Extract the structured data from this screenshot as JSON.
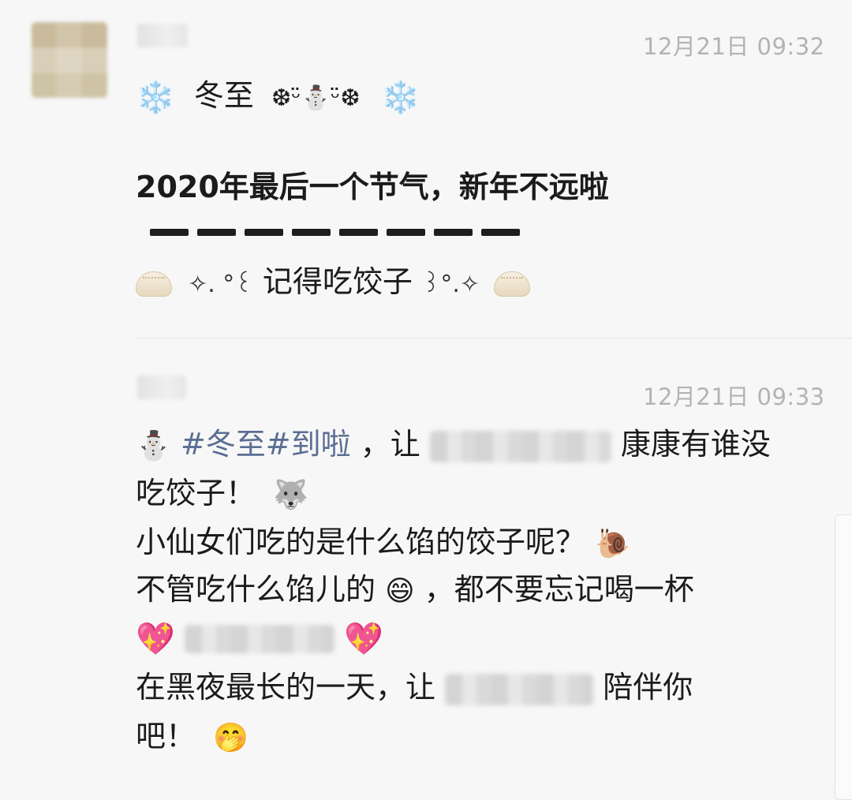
{
  "posts": [
    {
      "timestamp": "12月21日 09:32",
      "lines": {
        "title": {
          "pre": "❄️",
          "text": "冬至",
          "deco": "❆ᵕ̈⛄ᵕ̈❆",
          "post": "❄️"
        },
        "headline": "2020年最后一个节气，新年不远啦",
        "dashes_count": 8,
        "reminder": {
          "left_deco": "✧. °꒰",
          "text": "记得吃饺子",
          "right_deco": "꒱°.✧"
        }
      }
    },
    {
      "timestamp": "12月21日 09:33",
      "lines": {
        "l1_emoji": "⛄",
        "l1_hashtag": "#冬至#到啦",
        "l1_text_a": "，让",
        "l1_text_b": "康康有谁没",
        "l2_text": "吃饺子！",
        "l2_emoji": "🐺",
        "l3_text": "小仙女们吃的是什么馅的饺子呢？",
        "l3_emoji": "🐌",
        "l4_text_a": "不管吃什么馅儿的",
        "l4_emoji": "😄",
        "l4_text_b": "，都不要忘记喝一杯",
        "l5_heart_left": "💖",
        "l5_heart_right": "💖",
        "l6_text_a": "在黑夜最长的一天，让",
        "l6_text_b": "陪伴你",
        "l7_text": "吧！",
        "l7_emoji": "🤭"
      }
    }
  ],
  "colors": {
    "hashtag": "#5b6e93",
    "timestamp": "#b3b3b3",
    "snowflake": "#8fc8f0"
  }
}
